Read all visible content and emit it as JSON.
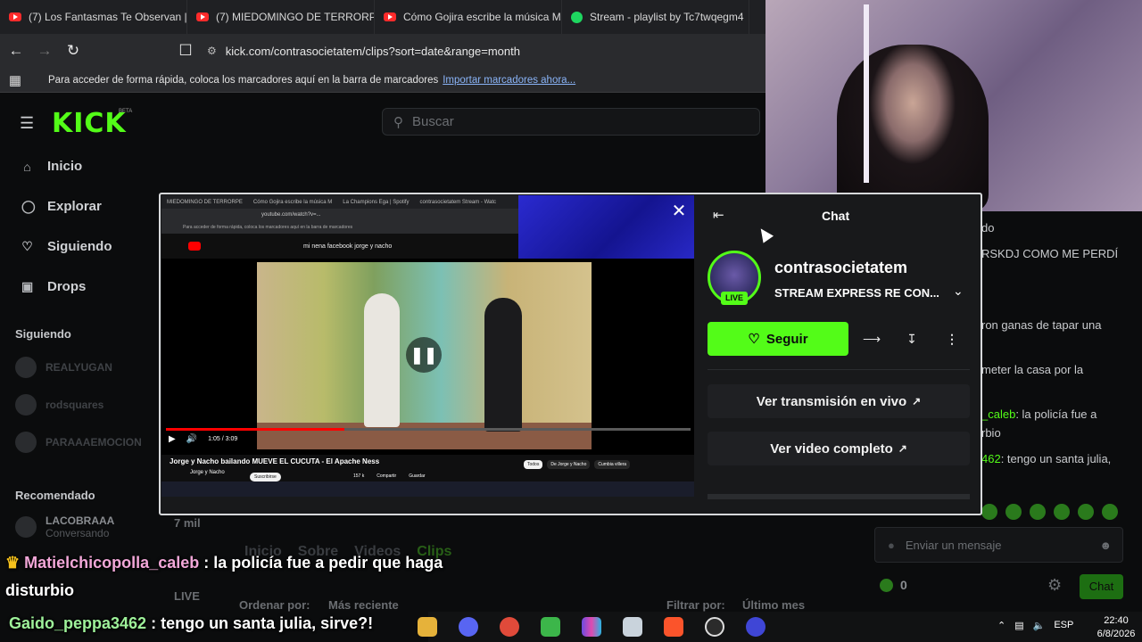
{
  "tabs": [
    {
      "icon": "youtube-icon",
      "label": "(7) Los Fantasmas Te Observan | (("
    },
    {
      "icon": "youtube-icon",
      "label": "(7) MIEDOMINGO DE TERRORPE"
    },
    {
      "icon": "youtube-icon",
      "label": "Cómo Gojira escribe la música M"
    },
    {
      "icon": "spotify-icon",
      "label": "Stream - playlist by Tc7twqegm4"
    }
  ],
  "address": {
    "url": "kick.com/contrasocietatem/clips?sort=date&range=month"
  },
  "bookmarks": {
    "hint": "Para acceder de forma rápida, coloca los marcadores aquí en la barra de marcadores",
    "import_link": "Importar marcadores ahora..."
  },
  "kick": {
    "logo": "KICK",
    "beta": "BETA",
    "search_placeholder": "Buscar",
    "nav": [
      {
        "label": "Inicio",
        "icon": "home-icon"
      },
      {
        "label": "Explorar",
        "icon": "compass-icon"
      },
      {
        "label": "Siguiendo",
        "icon": "heart-icon"
      },
      {
        "label": "Drops",
        "icon": "gift-icon"
      }
    ],
    "following_heading": "Siguiendo",
    "following": [
      "REALYUGAN",
      "rodsquares",
      "PARAAAEMOCION"
    ],
    "recommended_heading": "Recomendado",
    "recommended": {
      "name": "LACOBRAAA",
      "status": "Conversando"
    },
    "viewers": "7 mil",
    "live": "LIVE",
    "page_tabs": [
      "Inicio",
      "Sobre",
      "Videos",
      "Clips"
    ],
    "sort_label": "Ordenar por:",
    "sort_value": "Más reciente",
    "filter_label": "Filtrar por:",
    "filter_value": "Último mes"
  },
  "modal": {
    "chat_title": "Chat",
    "channel_name": "contrasocietatem",
    "stream_title": "STREAM EXPRESS RE CON...",
    "live_badge": "LIVE",
    "follow_button": "Seguir",
    "watch_live_button": "Ver transmisión en vivo",
    "full_video_button": "Ver video completo"
  },
  "inner_video": {
    "tabs": [
      "MIEDOMINGO DE TERRORPE",
      "Cómo Gojira escribe la música M",
      "La Champions Ega | Spotify",
      "contrasocietatem Stream - Watc"
    ],
    "url": "youtube.com/watch?v=...",
    "search": "mi nena facebook jorge y nacho",
    "title": "Jorge y Nacho bailando MUEVE EL CUCUTA - El Apache Ness",
    "time": "1:05 / 3:09",
    "channel": "Jorge y Nacho",
    "subscribe": "Suscribirse",
    "likes": "157 k",
    "share": "Compartir",
    "save": "Guardar",
    "chips": [
      "Todos",
      "De Jorge y Nacho",
      "Cumbia villera"
    ],
    "progress": 0.34
  },
  "right_chat": [
    {
      "name": "",
      "text": "do"
    },
    {
      "name": "",
      "text": "RSKDJ COMO ME PERDÍ"
    },
    {
      "name": "",
      "text": "ron ganas de tapar una"
    },
    {
      "name": "",
      "text": "meter la casa por la"
    },
    {
      "name": "_caleb",
      "text": ": la policía fue a"
    },
    {
      "name": "",
      "text": "rbio"
    },
    {
      "name": "462",
      "text": ": tengo un santa julia,"
    }
  ],
  "chat_input_placeholder": "Enviar un mensaje",
  "chat_count": "0",
  "chat_button": "Chat",
  "overlay": [
    {
      "user": "Matielchicopolla_caleb",
      "text": " : la policía fue a pedir que haga",
      "cont": "disturbio"
    },
    {
      "user": "Gaido_peppa3462",
      "text": " : tengo un santa julia, sirve?!"
    }
  ],
  "taskbar": {
    "lang": "ESP",
    "time": "22:40",
    "date": "6/8/2026"
  },
  "colors": {
    "kick_green": "#53fc18",
    "background": "#0b0c0d"
  }
}
